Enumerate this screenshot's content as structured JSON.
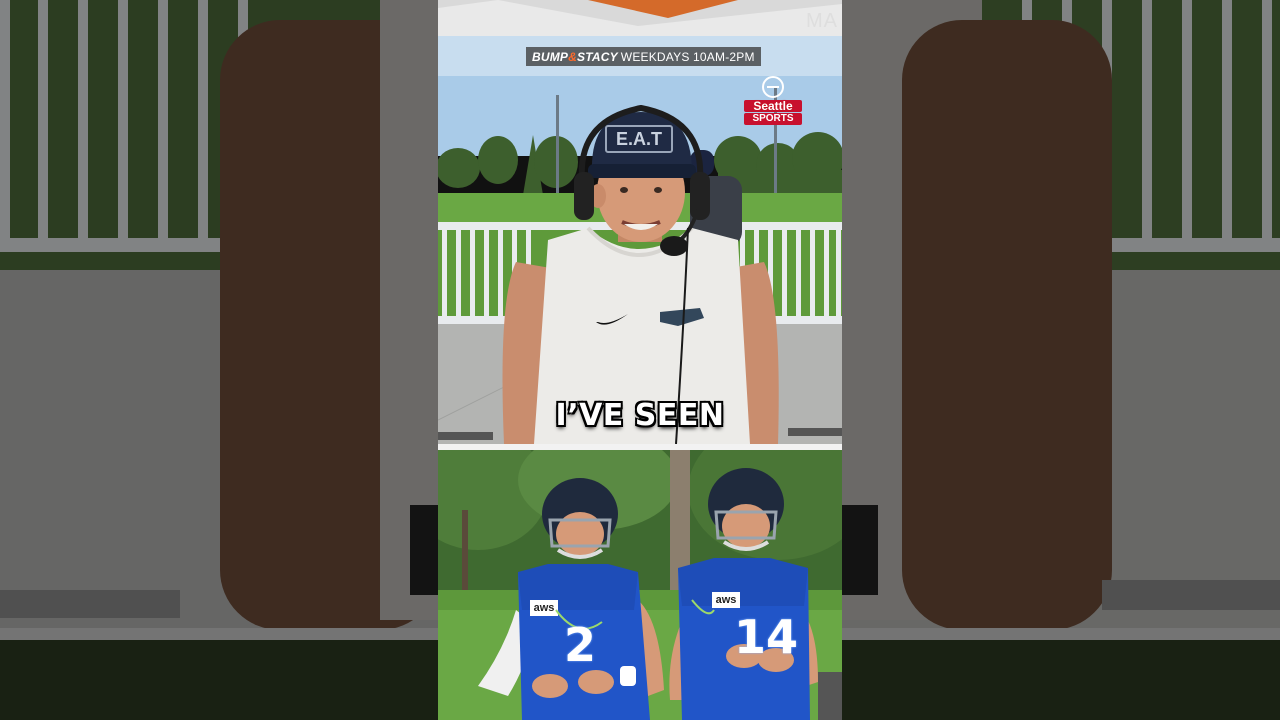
{
  "banner": {
    "brand_left": "BUMP",
    "brand_amp": "&",
    "brand_right": "STACY",
    "schedule": "WEEKDAYS 10AM-2PM"
  },
  "station": {
    "line1": "Seattle",
    "line2": "SPORTS"
  },
  "tent_text": "MA",
  "hat_text": "E.A.T",
  "caption": "I’VE SEEN",
  "players": [
    {
      "number": "2",
      "sponsor": "aws"
    },
    {
      "number": "14",
      "sponsor": "aws"
    }
  ],
  "colors": {
    "seahawks_blue": "#2155c8",
    "helmet_navy": "#1f2a3d",
    "sky": "#a9cbe8",
    "grass": "#5e9a3a",
    "fence": "#e8ebee"
  }
}
